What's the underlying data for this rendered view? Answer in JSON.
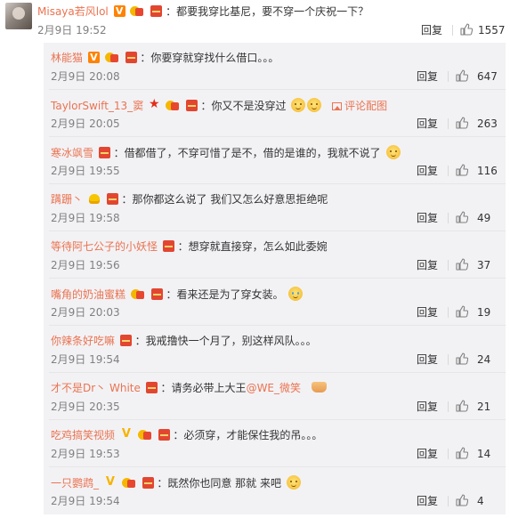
{
  "main_comment": {
    "username": "Misaya若风lol",
    "text": "：都要我穿比基尼，要不穿一个庆祝一下？",
    "time": "2月9日 19:52",
    "reply_label": "回复",
    "likes": "1557"
  },
  "replies": [
    {
      "username": "林能猫",
      "text": "：你要穿就穿找什么借口。。。",
      "time": "2月9日 20:08",
      "reply_label": "回复",
      "likes": "647"
    },
    {
      "username": "TaylorSwift_13_窦",
      "text": "：你又不是没穿过",
      "image_link": "评论配图",
      "time": "2月9日 20:05",
      "reply_label": "回复",
      "likes": "263"
    },
    {
      "username": "寒冰飒雪",
      "text": "：借都借了，不穿可惜了是不，借的是谁的，我就不说了",
      "time": "2月9日 19:55",
      "reply_label": "回复",
      "likes": "116"
    },
    {
      "username": "蹒跚丶",
      "text": "：那你都这么说了 我们又怎么好意思拒绝呢",
      "time": "2月9日 19:58",
      "reply_label": "回复",
      "likes": "49"
    },
    {
      "username": "等待阿七公子的小妖怪",
      "text": "：想穿就直接穿，怎么如此委婉",
      "time": "2月9日 19:56",
      "reply_label": "回复",
      "likes": "37"
    },
    {
      "username": "嘴角的奶油蜜糕",
      "text": "：看来还是为了穿女装。",
      "time": "2月9日 20:03",
      "reply_label": "回复",
      "likes": "19"
    },
    {
      "username": "你辣条好吃嘛",
      "text": "：我戒撸快一个月了，别这样风队。。。",
      "time": "2月9日 19:54",
      "reply_label": "回复",
      "likes": "24"
    },
    {
      "username": "才不是Dr丶 White",
      "text": "：请务必带上大王",
      "mention": "@WE_微笑",
      "time": "2月9日 20:35",
      "reply_label": "回复",
      "likes": "21"
    },
    {
      "username": "吃鸡搞笑视频",
      "text": "：必须穿，才能保住我的吊。。。",
      "time": "2月9日 19:53",
      "reply_label": "回复",
      "likes": "14"
    },
    {
      "username": "一只鹦鹉_",
      "text": "：既然你也同意 那就 来吧",
      "time": "2月9日 19:54",
      "reply_label": "回复",
      "likes": "4"
    }
  ],
  "colors": {
    "username": "#eb7350",
    "text": "#333333",
    "time": "#808080",
    "reply_bg": "#f2f2f5",
    "badge_orange": "#ff8200",
    "badge_red": "#e24630"
  }
}
